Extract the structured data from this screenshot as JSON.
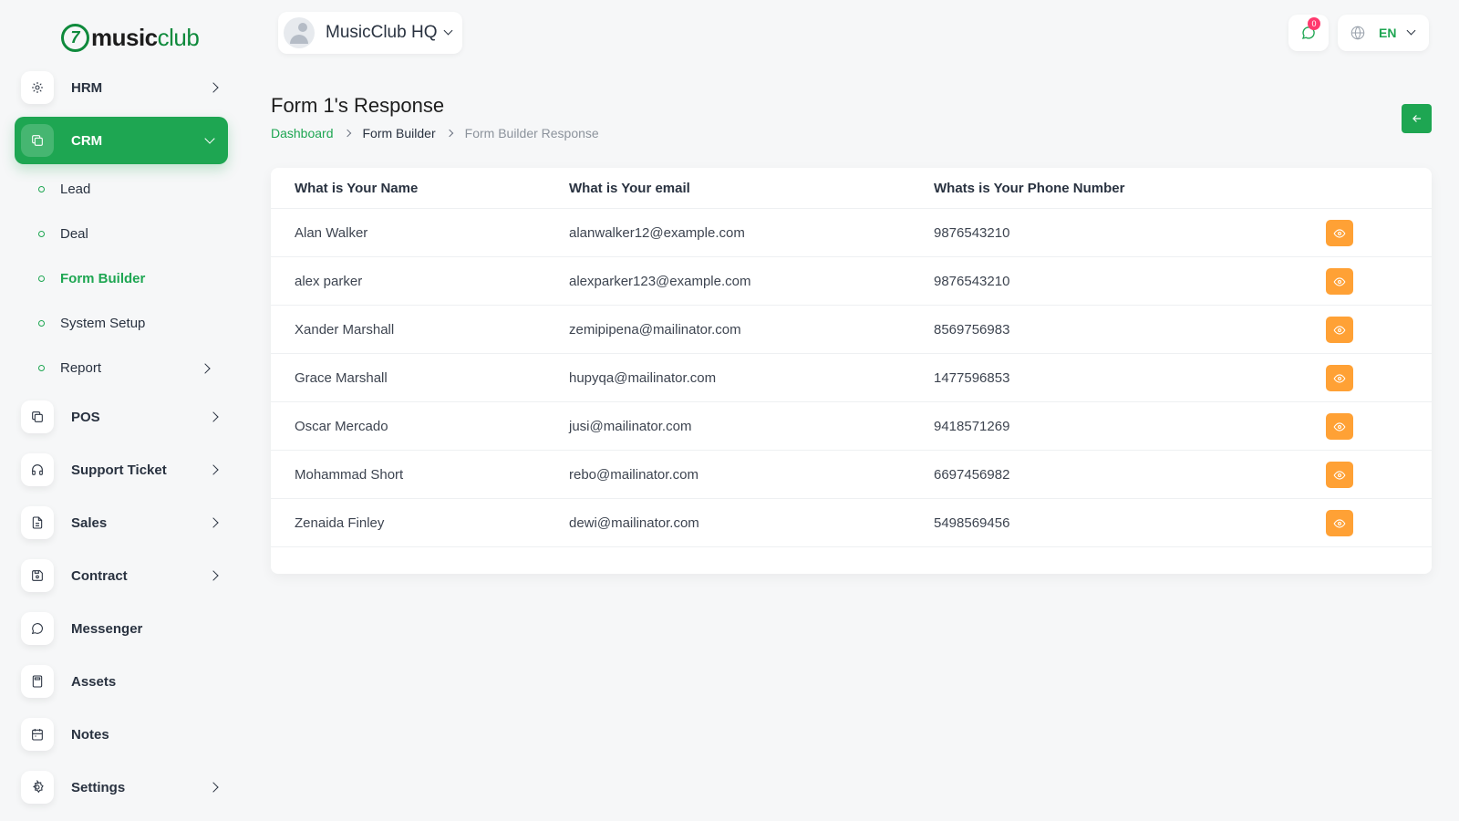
{
  "brand": {
    "logo_mark": "7",
    "name_bold": "music",
    "name_light": "club"
  },
  "colors": {
    "primary": "#1ea652",
    "view_button": "#ffa135",
    "badge": "#ff3a6e"
  },
  "sidebar": {
    "top_item": {
      "label": "HRM",
      "icon": "users-cog-icon"
    },
    "active_item": {
      "label": "CRM",
      "icon": "layers-icon",
      "children": [
        {
          "label": "Lead"
        },
        {
          "label": "Deal"
        },
        {
          "label": "Form Builder"
        },
        {
          "label": "System Setup"
        },
        {
          "label": "Report"
        }
      ]
    },
    "items": [
      {
        "label": "POS",
        "icon": "layers-icon"
      },
      {
        "label": "Support Ticket",
        "icon": "headphones-icon"
      },
      {
        "label": "Sales",
        "icon": "file-icon"
      },
      {
        "label": "Contract",
        "icon": "device-floppy-icon"
      },
      {
        "label": "Messenger",
        "icon": "message-circle-icon"
      },
      {
        "label": "Assets",
        "icon": "calculator-icon"
      },
      {
        "label": "Notes",
        "icon": "calendar-icon"
      },
      {
        "label": "Settings",
        "icon": "gear-icon"
      }
    ]
  },
  "header": {
    "workspace": "MusicClub HQ",
    "messages_badge": "0",
    "language": "EN"
  },
  "page": {
    "title": "Form 1's Response",
    "breadcrumb": [
      "Dashboard",
      "Form Builder",
      "Form Builder Response"
    ]
  },
  "table": {
    "columns": [
      "What is Your Name",
      "What is Your email",
      "Whats is Your Phone Number"
    ],
    "rows": [
      {
        "name": "Alan Walker",
        "email": "alanwalker12@example.com",
        "phone": "9876543210"
      },
      {
        "name": "alex parker",
        "email": "alexparker123@example.com",
        "phone": "9876543210"
      },
      {
        "name": "Xander Marshall",
        "email": "zemipipena@mailinator.com",
        "phone": "8569756983"
      },
      {
        "name": "Grace Marshall",
        "email": "hupyqa@mailinator.com",
        "phone": "1477596853"
      },
      {
        "name": "Oscar Mercado",
        "email": "jusi@mailinator.com",
        "phone": "9418571269"
      },
      {
        "name": "Mohammad Short",
        "email": "rebo@mailinator.com",
        "phone": "6697456982"
      },
      {
        "name": "Zenaida Finley",
        "email": "dewi@mailinator.com",
        "phone": "5498569456"
      }
    ]
  }
}
